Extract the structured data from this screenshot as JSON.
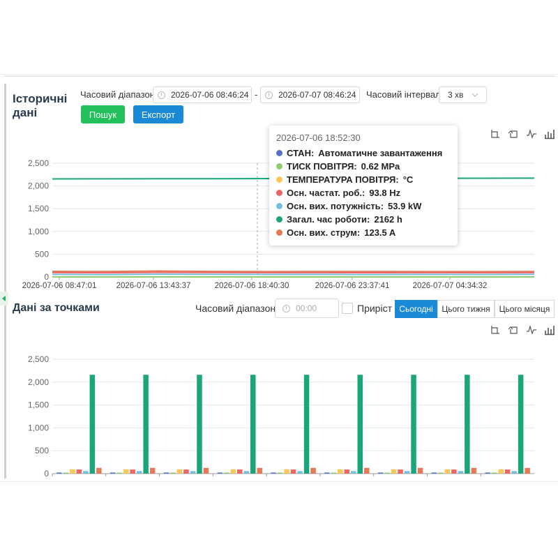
{
  "section1": {
    "title_line1": "Історичні",
    "title_line2": "дані",
    "time_range_label": "Часовий діапазон",
    "start": "2026-07-06 08:46:24",
    "separator": "-",
    "end": "2026-07-07 08:46:24",
    "interval_label": "Часовий інтервал",
    "interval_value": "3 хв",
    "search_button": "Пошук",
    "export_button": "Експорт"
  },
  "section2": {
    "title": "Дані за точками",
    "time_range_label": "Часовий діапазон",
    "time_placeholder": "00:00",
    "increment_label": "Приріст",
    "tabs": [
      "Сьогодні",
      "Цього тижня",
      "Цього місяця"
    ],
    "active_tab": 0
  },
  "colors": {
    "green_button": "#22c05a",
    "blue_button": "#1a8ad6",
    "series": [
      "#5470c6",
      "#91cc75",
      "#fac858",
      "#ee6666",
      "#73c0de",
      "#1aa57a",
      "#e47a57"
    ]
  },
  "icons": [
    "zoom-icon",
    "zoom-reset-icon",
    "line-chart-icon",
    "bar-chart-icon"
  ],
  "tooltip": {
    "time": "2026-07-06 18:52:30",
    "rows": [
      {
        "name": "СТАН:",
        "value": "Автоматичне завантаження"
      },
      {
        "name": "ТИСК ПОВІТРЯ:",
        "value": "0.62 MPa"
      },
      {
        "name": "ТЕМПЕРАТУРА ПОВІТРЯ:",
        "value": "°C"
      },
      {
        "name": "Осн. частат. роб.:",
        "value": "93.8 Hz"
      },
      {
        "name": "Осн. вих. потужність:",
        "value": "53.9 kW"
      },
      {
        "name": "Загал. час роботи:",
        "value": "2162 h"
      },
      {
        "name": "Осн. вих. струм:",
        "value": "123.5 A"
      }
    ]
  },
  "chart_data": [
    {
      "type": "line",
      "ylim": [
        0,
        2500
      ],
      "yticks": [
        "0",
        "500",
        "1,000",
        "1,500",
        "2,000",
        "2,500"
      ],
      "xticks": [
        "2026-07-06 08:47:01",
        "2026-07-06 13:43:37",
        "2026-07-06 18:40:30",
        "2026-07-06 23:37:41",
        "2026-07-07 04:34:32"
      ],
      "series": [
        {
          "name": "Загал. час роботи",
          "values": [
            2155,
            2157,
            2158,
            2160,
            2162,
            2164,
            2166,
            2168,
            2170,
            2172
          ]
        },
        {
          "name": "Осн. вих. струм",
          "values": [
            123,
            118,
            130,
            121,
            116,
            119,
            118,
            117,
            116,
            120
          ]
        },
        {
          "name": "Осн. частат. роб.",
          "values": [
            94,
            90,
            100,
            96,
            93,
            94,
            92,
            93,
            92,
            94
          ]
        },
        {
          "name": "Осн. вих. потужність",
          "values": [
            54,
            50,
            60,
            55,
            53,
            54,
            52,
            53,
            52,
            55
          ]
        },
        {
          "name": "ТИСК ПОВІТРЯ",
          "values": [
            0.6,
            0.6,
            0.6,
            0.6,
            0.6,
            0.6,
            0.6,
            0.6,
            0.6,
            0.6
          ]
        }
      ]
    },
    {
      "type": "bar",
      "ylim": [
        0,
        2500
      ],
      "yticks": [
        "0",
        "500",
        "1,000",
        "1,500",
        "2,000",
        "2,500"
      ],
      "groups": 9,
      "series_values": [
        0,
        1,
        95,
        90,
        55,
        2160,
        125
      ]
    }
  ]
}
